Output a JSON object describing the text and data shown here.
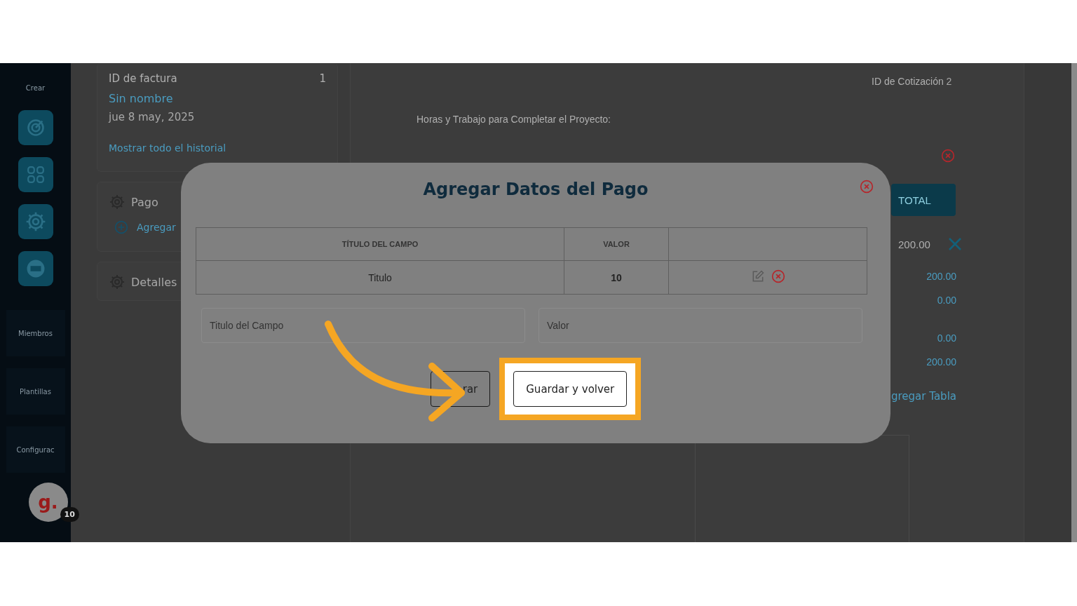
{
  "sidebar": {
    "section_label": "Crear",
    "labels": [
      "Miembros",
      "Plantillas",
      "Configurac"
    ],
    "avatar": {
      "letter": "g.",
      "badge": "10"
    }
  },
  "invoice_card": {
    "label": "ID de factura",
    "value": "1",
    "name": "Sin nombre",
    "date": "jue 8 may, 2025",
    "link": "Mostrar todo el historial"
  },
  "sections": [
    {
      "title": "Pago",
      "action": "Agregar"
    },
    {
      "title": "Detalles"
    }
  ],
  "quote": {
    "id_label": "ID de Cotización",
    "id_value": "2",
    "description": "Horas y Trabajo para Completar el Proyecto:",
    "total_header": "TOTAL",
    "row_value": "200.00",
    "totals": [
      "200.00",
      "0.00",
      "0.00",
      "200.00"
    ],
    "add_table_link": "gregar Tabla"
  },
  "modal": {
    "title": "Agregar Datos del Pago",
    "columns": [
      "TÍTULO DEL CAMPO",
      "VALOR"
    ],
    "rows": [
      {
        "field": "Titulo",
        "value": "10"
      }
    ],
    "fields": [
      {
        "placeholder": "Titulo del Campo"
      },
      {
        "placeholder": "Valor"
      }
    ],
    "buttons": [
      {
        "label": "rar",
        "highlighted": false
      },
      {
        "label": "Guardar y volver",
        "highlighted": true
      }
    ]
  }
}
